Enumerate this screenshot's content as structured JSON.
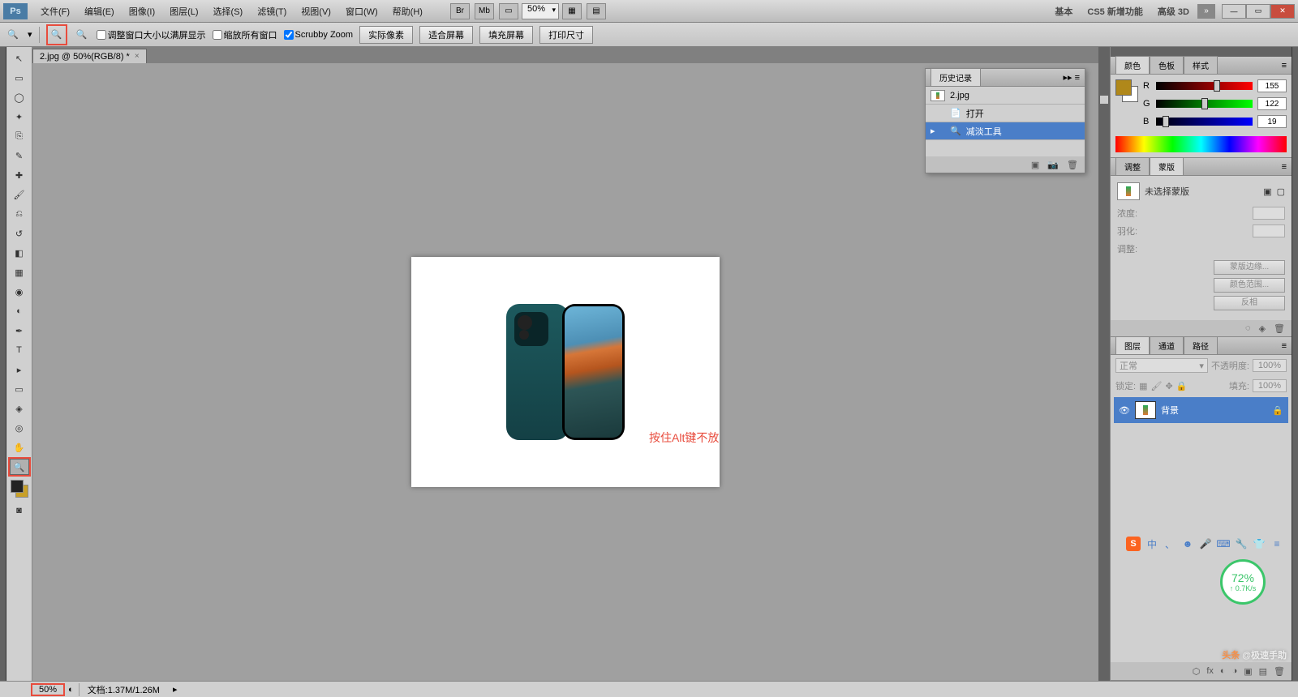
{
  "app": {
    "logo": "Ps"
  },
  "menu": {
    "file": "文件(F)",
    "edit": "编辑(E)",
    "image": "图像(I)",
    "layer": "图层(L)",
    "select": "选择(S)",
    "filter": "滤镜(T)",
    "view": "视图(V)",
    "window": "窗口(W)",
    "help": "帮助(H)"
  },
  "topIcons": {
    "br": "Br",
    "mb": "Mb"
  },
  "topZoom": "50%",
  "workspaces": {
    "basic": "基本",
    "cs5": "CS5 新增功能",
    "adv3d": "高级 3D"
  },
  "options": {
    "resize": "调整窗口大小以满屏显示",
    "zoom_all": "缩放所有窗口",
    "scrubby": "Scrubby Zoom",
    "actual": "实际像素",
    "fit": "适合屏幕",
    "fill": "填充屏幕",
    "print": "打印尺寸"
  },
  "doc": {
    "tab": "2.jpg @ 50%(RGB/8) *"
  },
  "annotation": "按住Alt键不放",
  "history": {
    "title": "历史记录",
    "file": "2.jpg",
    "open": "打开",
    "dodge": "减淡工具"
  },
  "panels": {
    "color": "颜色",
    "swatches": "色板",
    "styles": "样式",
    "adjust": "调整",
    "mask": "蒙版",
    "layers": "图层",
    "channels": "通道",
    "paths": "路径"
  },
  "color": {
    "r": "R",
    "rv": "155",
    "g": "G",
    "gv": "122",
    "b": "B",
    "bv": "19"
  },
  "mask": {
    "none": "未选择蒙版",
    "density": "浓度:",
    "feather": "羽化:",
    "refine": "调整:",
    "edge": "蒙版边缘...",
    "range": "颜色范围...",
    "invert": "反相"
  },
  "layers": {
    "mode": "正常",
    "opacity_lbl": "不透明度:",
    "opacity": "100%",
    "lock_lbl": "锁定:",
    "fill_lbl": "填充:",
    "fill": "100%",
    "bg": "背景"
  },
  "status": {
    "zoom": "50%",
    "doc": "文档:1.37M/1.26M"
  },
  "ime": {
    "s": "S",
    "cn": "中"
  },
  "net": {
    "pct": "72%",
    "spd": "↑ 0.7K/s"
  },
  "watermark": {
    "t1": "头条",
    "t2": " @极速手助"
  }
}
